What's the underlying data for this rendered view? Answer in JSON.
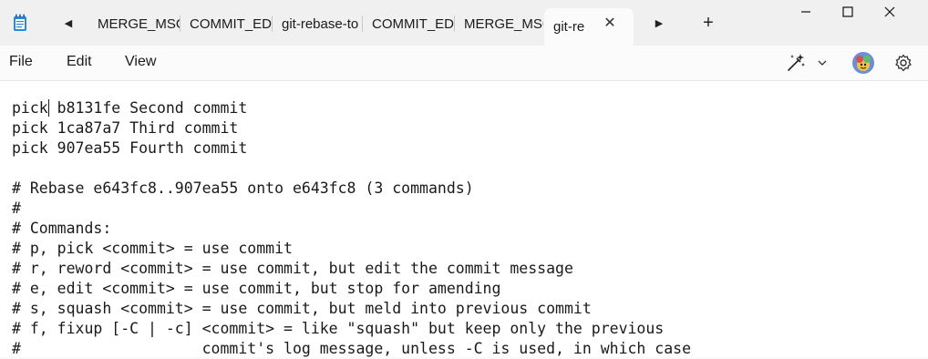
{
  "tabs": [
    {
      "label": "MERGE_MSG",
      "active": false
    },
    {
      "label": "COMMIT_ED",
      "active": false
    },
    {
      "label": "git-rebase-to",
      "active": false
    },
    {
      "label": "COMMIT_ED",
      "active": false
    },
    {
      "label": "MERGE_MSG",
      "active": false
    },
    {
      "label": "git-re",
      "active": true
    }
  ],
  "menu": {
    "file": "File",
    "edit": "Edit",
    "view": "View"
  },
  "icons": {
    "app": "notepad-icon",
    "scroll_left": "chevron-left-icon",
    "scroll_right": "chevron-right-icon",
    "new_tab": "plus-icon",
    "close_tab": "close-icon",
    "copilot": "copilot-sparkle-icon",
    "profile": "avatar",
    "settings": "gear-icon"
  },
  "editor": {
    "lines": [
      "pick b8131fe Second commit",
      "pick 1ca87a7 Third commit",
      "pick 907ea55 Fourth commit",
      "",
      "# Rebase e643fc8..907ea55 onto e643fc8 (3 commands)",
      "#",
      "# Commands:",
      "# p, pick <commit> = use commit",
      "# r, reword <commit> = use commit, but edit the commit message",
      "# e, edit <commit> = use commit, but stop for amending",
      "# s, squash <commit> = use commit, but meld into previous commit",
      "# f, fixup [-C | -c] <commit> = like \"squash\" but keep only the previous",
      "#                    commit's log message, unless -C is used, in which case"
    ]
  }
}
